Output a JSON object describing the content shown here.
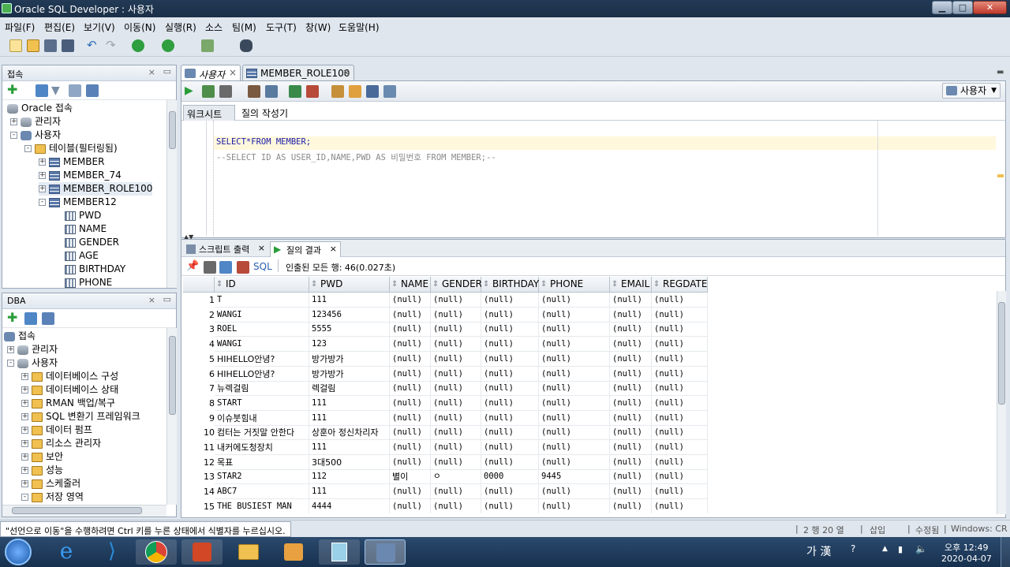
{
  "window": {
    "title": "Oracle SQL Developer : 사용자",
    "min": "▁",
    "max": "□",
    "close": "✕"
  },
  "menu": [
    "파일(F)",
    "편집(E)",
    "보기(V)",
    "이동(N)",
    "실행(R)",
    "소스",
    "팀(M)",
    "도구(T)",
    "창(W)",
    "도움말(H)"
  ],
  "connections_panel": {
    "title": "접속",
    "tree": [
      {
        "label": "Oracle 접속",
        "icon": "db"
      },
      {
        "label": "관리자",
        "icon": "db",
        "exp": "+"
      },
      {
        "label": "사용자",
        "icon": "user",
        "exp": "-"
      },
      {
        "label": "테이블(필터링됨)",
        "icon": "fld",
        "exp": "-"
      },
      {
        "label": "MEMBER",
        "icon": "tbl",
        "exp": "+"
      },
      {
        "label": "MEMBER_74",
        "icon": "tbl",
        "exp": "+"
      },
      {
        "label": "MEMBER_ROLE100",
        "icon": "tbl",
        "exp": "+"
      },
      {
        "label": "MEMBER12",
        "icon": "tbl",
        "exp": "-"
      },
      {
        "label": "PWD",
        "icon": "col"
      },
      {
        "label": "NAME",
        "icon": "col"
      },
      {
        "label": "GENDER",
        "icon": "col"
      },
      {
        "label": "AGE",
        "icon": "col"
      },
      {
        "label": "BIRTHDAY",
        "icon": "col"
      },
      {
        "label": "PHONE",
        "icon": "col"
      }
    ]
  },
  "dba_panel": {
    "title": "DBA",
    "tree": [
      {
        "label": "접속",
        "icon": "user"
      },
      {
        "label": "관리자",
        "icon": "db",
        "exp": "+"
      },
      {
        "label": "사용자",
        "icon": "db",
        "exp": "-"
      },
      {
        "label": "데이터베이스 구성",
        "icon": "fld",
        "exp": "+"
      },
      {
        "label": "데이터베이스 상태",
        "icon": "fld",
        "exp": "+"
      },
      {
        "label": "RMAN 백업/복구",
        "icon": "fld",
        "exp": "+"
      },
      {
        "label": "SQL 변환기 프레임워크",
        "icon": "fld",
        "exp": "+"
      },
      {
        "label": "데이터 펌프",
        "icon": "fld",
        "exp": "+"
      },
      {
        "label": "리소스 관리자",
        "icon": "fld",
        "exp": "+"
      },
      {
        "label": "보안",
        "icon": "fld",
        "exp": "+"
      },
      {
        "label": "성능",
        "icon": "fld",
        "exp": "+"
      },
      {
        "label": "스케줄러",
        "icon": "fld",
        "exp": "+"
      },
      {
        "label": "저장 영역",
        "icon": "fld",
        "exp": "-"
      }
    ]
  },
  "editor": {
    "tabs": [
      "사용자",
      "MEMBER_ROLE100"
    ],
    "connection": "사용자",
    "subtabs": [
      "워크시트",
      "질의 작성기"
    ],
    "lines": [
      "SELECT*FROM MEMBER;",
      "--SELECT ID AS USER_ID,NAME,PWD AS 비밀번호 FROM MEMBER;--"
    ]
  },
  "results": {
    "tabs": [
      "스크립트 출력",
      "질의 결과"
    ],
    "sql_label": "SQL",
    "fetch_status": "인출된 모든 행: 46(0.027초)",
    "columns": [
      "ID",
      "PWD",
      "NAME",
      "GENDER",
      "BIRTHDAY",
      "PHONE",
      "EMAIL",
      "REGDATE"
    ],
    "rows": [
      [
        "1",
        "T",
        "111",
        "(null)",
        "(null)",
        "(null)",
        "(null)",
        "(null)",
        "(null)"
      ],
      [
        "2",
        "WANGI",
        "123456",
        "(null)",
        "(null)",
        "(null)",
        "(null)",
        "(null)",
        "(null)"
      ],
      [
        "3",
        "ROEL",
        "5555",
        "(null)",
        "(null)",
        "(null)",
        "(null)",
        "(null)",
        "(null)"
      ],
      [
        "4",
        "WANGI",
        "123",
        "(null)",
        "(null)",
        "(null)",
        "(null)",
        "(null)",
        "(null)"
      ],
      [
        "5",
        "HIHELLO안녕?",
        "방가방가",
        "(null)",
        "(null)",
        "(null)",
        "(null)",
        "(null)",
        "(null)"
      ],
      [
        "6",
        "HIHELLO안녕?",
        "방가방가",
        "(null)",
        "(null)",
        "(null)",
        "(null)",
        "(null)",
        "(null)"
      ],
      [
        "7",
        "뉴렉걸림",
        "렉걸림",
        "(null)",
        "(null)",
        "(null)",
        "(null)",
        "(null)",
        "(null)"
      ],
      [
        "8",
        "START",
        "111",
        "(null)",
        "(null)",
        "(null)",
        "(null)",
        "(null)",
        "(null)"
      ],
      [
        "9",
        "이슈붓힘내",
        "111",
        "(null)",
        "(null)",
        "(null)",
        "(null)",
        "(null)",
        "(null)"
      ],
      [
        "10",
        "컴터는 거짓말 안한다",
        "상훈아 정신차리자",
        "(null)",
        "(null)",
        "(null)",
        "(null)",
        "(null)",
        "(null)"
      ],
      [
        "11",
        "내커에도청장치",
        "111",
        "(null)",
        "(null)",
        "(null)",
        "(null)",
        "(null)",
        "(null)"
      ],
      [
        "12",
        "목표",
        "3대500",
        "(null)",
        "(null)",
        "(null)",
        "(null)",
        "(null)",
        "(null)"
      ],
      [
        "13",
        "STAR2",
        "112",
        "별이",
        "ㅇ",
        "0000",
        "9445",
        "(null)",
        "(null)"
      ],
      [
        "14",
        "ABC7",
        "111",
        "(null)",
        "(null)",
        "(null)",
        "(null)",
        "(null)",
        "(null)"
      ],
      [
        "15",
        "THE BUSIEST MAN",
        "4444",
        "(null)",
        "(null)",
        "(null)",
        "(null)",
        "(null)",
        "(null)"
      ]
    ]
  },
  "status": {
    "message": "\"선언으로 이동\"을 수행하려면 Ctrl 키를 누른 상태에서 식별자를 누르십시오.",
    "position": "2 행 20 열",
    "insert": "삽입",
    "modified": "수정됨",
    "line_ending": "Windows: CR"
  },
  "taskbar": {
    "ime": "가 漢",
    "time": "오후 12:49",
    "date": "2020-04-07"
  }
}
